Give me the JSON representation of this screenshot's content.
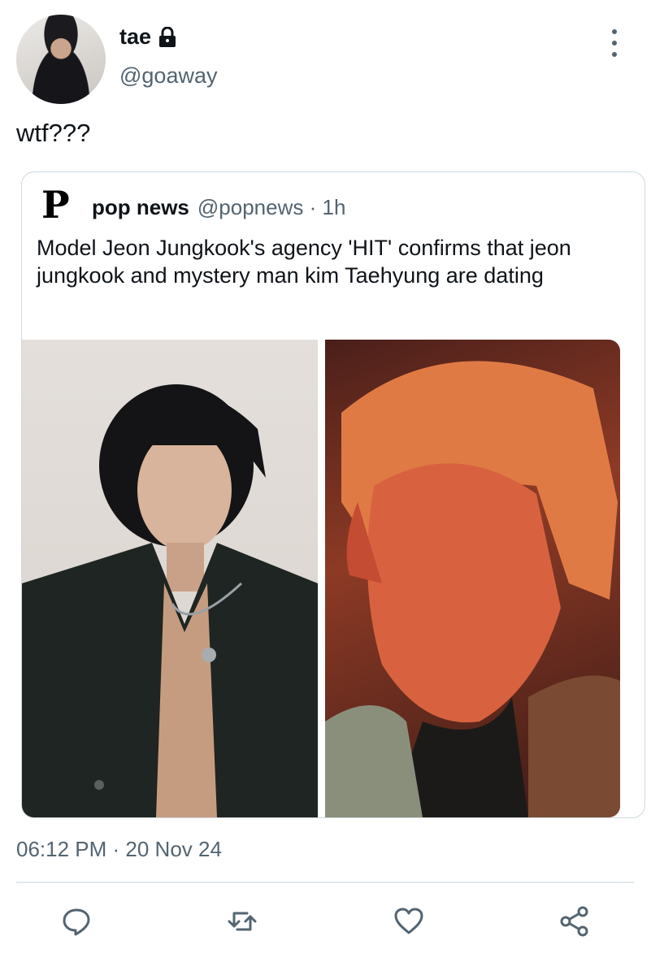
{
  "user": {
    "display_name": "tae",
    "handle": "@goaway",
    "protected": true
  },
  "tweet": {
    "text": "wtf???",
    "timestamp": "06:12 PM · 20 Nov 24"
  },
  "quoted": {
    "logo_letter": "P",
    "name": "pop news",
    "meta": "@popnews · 1h",
    "text": "Model Jeon Jungkook's agency 'HIT' confirms that jeon jungkook and mystery man kim Taehyung are dating",
    "photos": [
      {
        "description_icon": "photo-portrait-dark-jacket"
      },
      {
        "description_icon": "photo-portrait-orange-hair"
      }
    ]
  },
  "actions": {
    "reply_icon": "reply-icon",
    "retweet_icon": "retweet-icon",
    "like_icon": "like-icon",
    "share_icon": "share-icon"
  },
  "colors": {
    "text": "#0f1419",
    "secondary": "#536471",
    "border": "#cfd9de"
  }
}
